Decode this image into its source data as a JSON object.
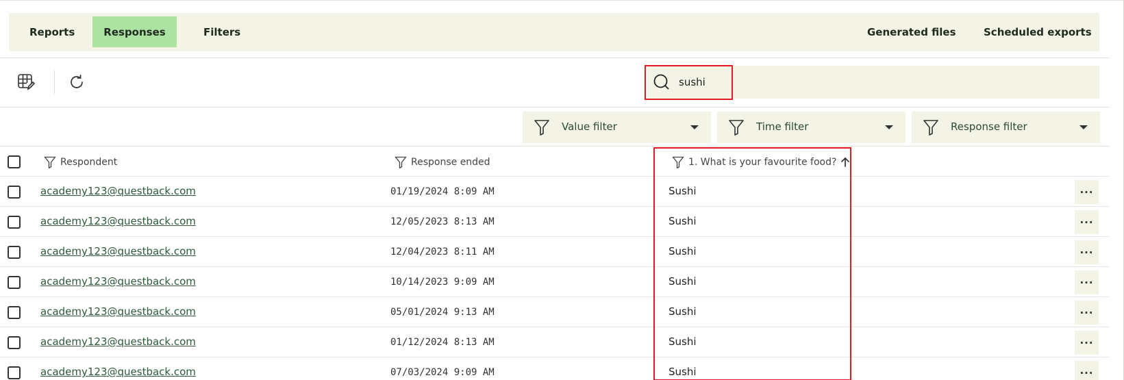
{
  "nav": {
    "tabs": [
      {
        "label": "Reports",
        "active": false
      },
      {
        "label": "Responses",
        "active": true
      },
      {
        "label": "Filters",
        "active": false
      }
    ],
    "right_tabs": [
      {
        "label": "Generated files"
      },
      {
        "label": "Scheduled exports"
      }
    ]
  },
  "toolbar": {
    "icons": [
      "table-edit-icon",
      "refresh-icon"
    ],
    "search": {
      "value": "sushi",
      "icon": "search-icon"
    }
  },
  "filters": [
    {
      "label": "Value filter"
    },
    {
      "label": "Time filter"
    },
    {
      "label": "Response filter"
    }
  ],
  "table": {
    "columns": [
      "Respondent",
      "Response ended",
      "1. What is your favourite food?"
    ],
    "sort": "ascending",
    "rows": [
      {
        "respondent": "academy123@questback.com",
        "ended": "01/19/2024 8:09 AM",
        "answer": "Sushi"
      },
      {
        "respondent": "academy123@questback.com",
        "ended": "12/05/2023 8:13 AM",
        "answer": "Sushi"
      },
      {
        "respondent": "academy123@questback.com",
        "ended": "12/04/2023 8:11 AM",
        "answer": "Sushi"
      },
      {
        "respondent": "academy123@questback.com",
        "ended": "10/14/2023 9:09 AM",
        "answer": "Sushi"
      },
      {
        "respondent": "academy123@questback.com",
        "ended": "05/01/2024 9:13 AM",
        "answer": "Sushi"
      },
      {
        "respondent": "academy123@questback.com",
        "ended": "01/12/2024 8:13 AM",
        "answer": "Sushi"
      },
      {
        "respondent": "academy123@questback.com",
        "ended": "07/03/2024 9:09 AM",
        "answer": "Sushi"
      }
    ],
    "row_action_label": "..."
  },
  "colors": {
    "accent_tab": "#ade3a2",
    "panel_bg": "#f3f3e6",
    "highlight": "#e01b22",
    "link": "#2d5a3a"
  }
}
